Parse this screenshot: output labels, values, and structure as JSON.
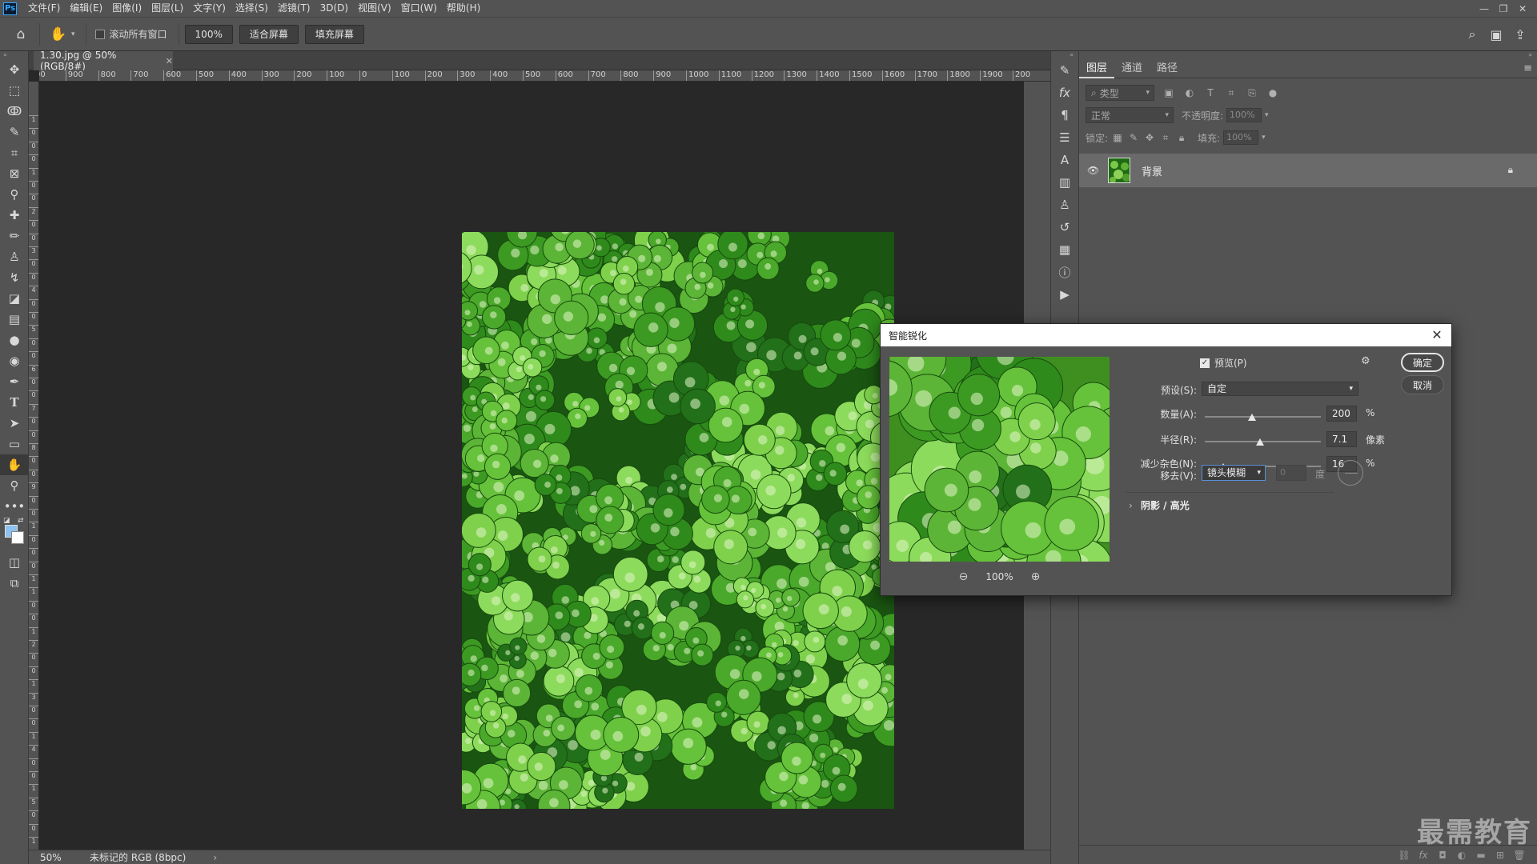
{
  "app": {
    "logo": "Ps"
  },
  "menu": [
    "文件(F)",
    "编辑(E)",
    "图像(I)",
    "图层(L)",
    "文字(Y)",
    "选择(S)",
    "滤镜(T)",
    "3D(D)",
    "视图(V)",
    "窗口(W)",
    "帮助(H)"
  ],
  "options": {
    "scroll_all_label": "滚动所有窗口",
    "zoom_btn": "100%",
    "fit_screen": "适合屏幕",
    "fill_screen": "填充屏幕"
  },
  "document": {
    "tab_title": "1.30.jpg @ 50%(RGB/8#)",
    "ruler_h": [
      "00",
      "900",
      "800",
      "700",
      "600",
      "500",
      "400",
      "300",
      "200",
      "100",
      "0",
      "100",
      "200",
      "300",
      "400",
      "500",
      "600",
      "700",
      "800",
      "900",
      "1000",
      "1100",
      "1200",
      "1300",
      "1400",
      "1500",
      "1600",
      "1700",
      "1800",
      "1900",
      "200"
    ],
    "ruler_v": [
      "1",
      "0",
      "0",
      "0",
      "1",
      "0",
      "0",
      "2",
      "0",
      "0",
      "3",
      "0",
      "0",
      "4",
      "0",
      "0",
      "5",
      "0",
      "0",
      "6",
      "0",
      "0",
      "7",
      "0",
      "0",
      "8",
      "0",
      "0",
      "9",
      "0",
      "0",
      "1",
      "0",
      "0",
      "0",
      "1",
      "1",
      "0",
      "0",
      "1",
      "2",
      "0",
      "0",
      "1",
      "3",
      "0",
      "0",
      "1",
      "4",
      "0",
      "0",
      "1",
      "5",
      "0",
      "0",
      "1",
      "6",
      "0"
    ]
  },
  "status": {
    "zoom": "50%",
    "info": "未标记的 RGB (8bpc)",
    "arrow": "›"
  },
  "layers_panel": {
    "tabs": [
      "图层",
      "通道",
      "路径"
    ],
    "filter_type": "类型",
    "blend_mode": "正常",
    "opacity_label": "不透明度:",
    "opacity_value": "100%",
    "lock_label": "锁定:",
    "fill_label": "填充:",
    "fill_value": "100%",
    "layer_name": "背景"
  },
  "watermark": "最需教育",
  "dialog": {
    "title": "智能锐化",
    "preview_label": "预览(P)",
    "preview_checked": true,
    "ok": "确定",
    "cancel": "取消",
    "preset_label": "预设(S):",
    "preset_value": "自定",
    "amount_label": "数量(A):",
    "amount_value": "200",
    "amount_unit": "%",
    "radius_label": "半径(R):",
    "radius_value": "7.1",
    "radius_unit": "像素",
    "noise_label": "减少杂色(N):",
    "noise_value": "16",
    "noise_unit": "%",
    "remove_label": "移去(V):",
    "remove_value": "镜头模糊",
    "angle_value": "0",
    "angle_unit": "度",
    "shadow_highlight": "阴影 / 高光",
    "zoom_value": "100%"
  },
  "colors": {
    "foreground": "#8cc2ef",
    "background": "#ffffff",
    "canvas": "#282828",
    "ui": "#535353"
  }
}
